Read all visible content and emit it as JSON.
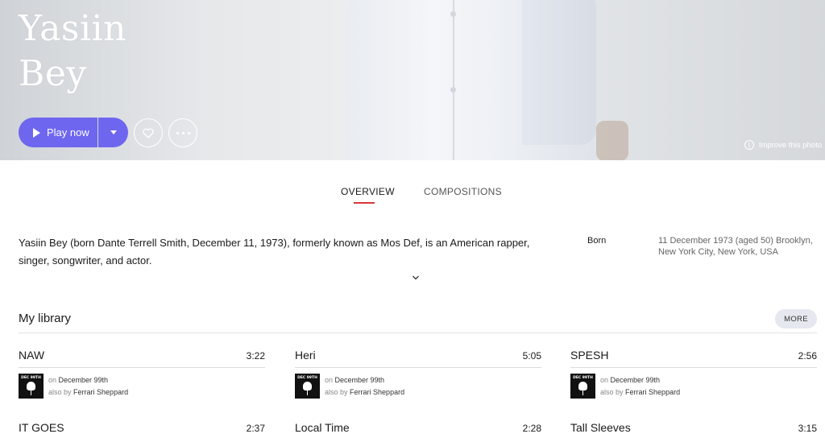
{
  "hero": {
    "name_line1": "Yasiin",
    "name_line2": "Bey",
    "play_label": "Play now",
    "improve_label": "Improve this photo",
    "accent_color": "#6e66ef"
  },
  "tabs": [
    {
      "label": "OVERVIEW",
      "active": true
    },
    {
      "label": "COMPOSITIONS",
      "active": false
    }
  ],
  "bio": {
    "text": "Yasiin Bey (born Dante Terrell Smith, December 11, 1973), formerly known as Mos Def, is an American rapper, singer, songwriter, and actor.",
    "born_label": "Born",
    "born_value": "11 December 1973 (aged 50) Brooklyn, New York City, New York, USA"
  },
  "library": {
    "title": "My library",
    "more_label": "MORE",
    "tracks": [
      {
        "title": "NAW",
        "duration": "3:22",
        "on_prefix": "on",
        "album": "December 99th",
        "by_prefix": "also by",
        "artist": "Ferrari Sheppard",
        "cover_text": "DEC 99TH"
      },
      {
        "title": "Heri",
        "duration": "5:05",
        "on_prefix": "on",
        "album": "December 99th",
        "by_prefix": "also by",
        "artist": "Ferrari Sheppard",
        "cover_text": "DEC 99TH"
      },
      {
        "title": "SPESH",
        "duration": "2:56",
        "on_prefix": "on",
        "album": "December 99th",
        "by_prefix": "also by",
        "artist": "Ferrari Sheppard",
        "cover_text": "DEC 99TH"
      },
      {
        "title": "IT GOES",
        "duration": "2:37"
      },
      {
        "title": "Local Time",
        "duration": "2:28"
      },
      {
        "title": "Tall Sleeves",
        "duration": "3:15"
      }
    ]
  }
}
